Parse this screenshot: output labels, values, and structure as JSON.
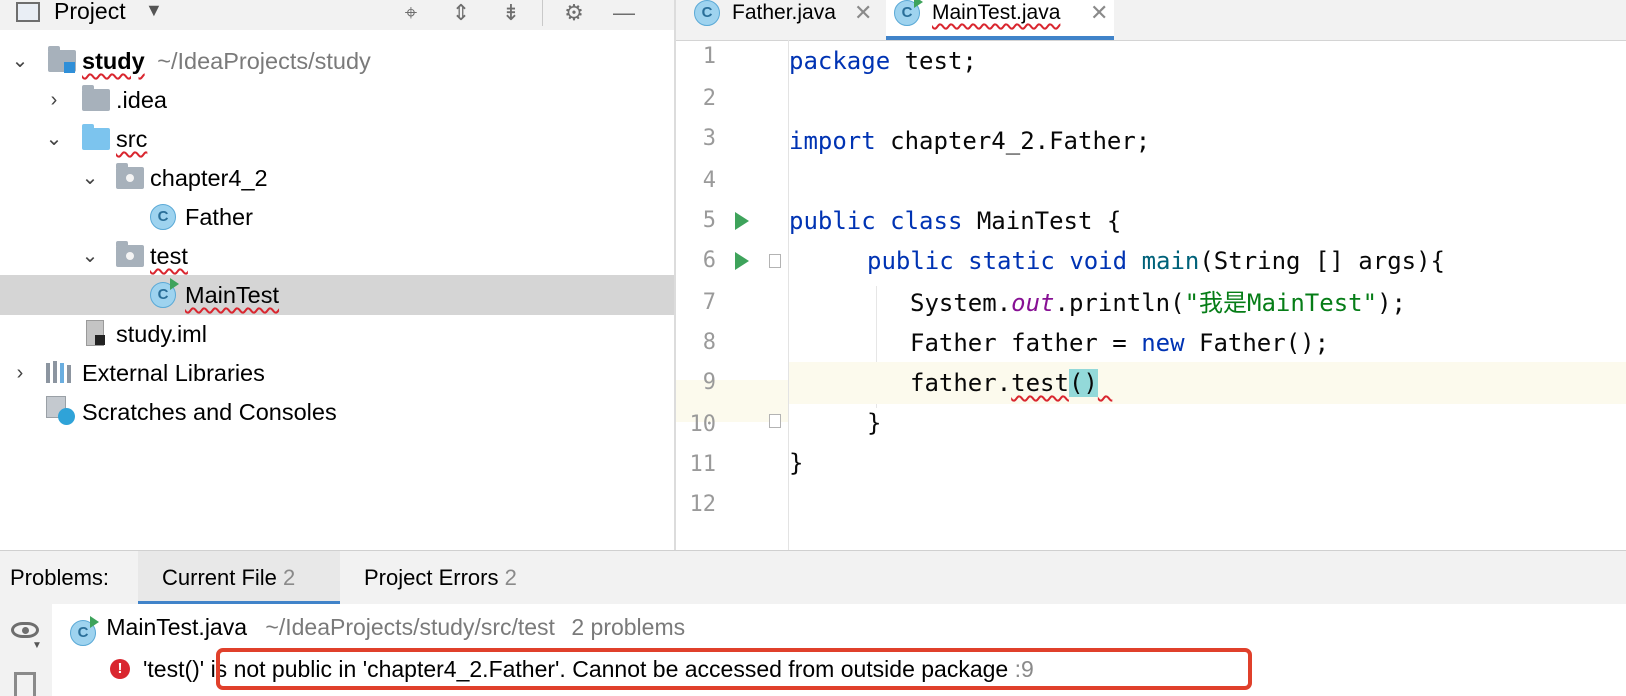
{
  "project_panel": {
    "title": "Project",
    "tree": [
      {
        "label": "study",
        "extra": "~/IdeaProjects/study"
      },
      {
        "label": ".idea"
      },
      {
        "label": "src"
      },
      {
        "label": "chapter4_2"
      },
      {
        "label": "Father"
      },
      {
        "label": "test"
      },
      {
        "label": "MainTest"
      },
      {
        "label": "study.iml"
      },
      {
        "label": "External Libraries"
      },
      {
        "label": "Scratches and Consoles"
      }
    ],
    "selected": "MainTest"
  },
  "editor": {
    "tabs": [
      {
        "label": "Father.java",
        "active": false
      },
      {
        "label": "MainTest.java",
        "active": true
      }
    ],
    "line_numbers": [
      "1",
      "2",
      "3",
      "4",
      "5",
      "6",
      "7",
      "8",
      "9",
      "10",
      "11",
      "12"
    ],
    "current_line": "9",
    "code": {
      "l1_kw": "package",
      "l1_rest": " test;",
      "l3_kw": "import",
      "l3_rest": " chapter4_2.Father;",
      "l5_kw1": "public",
      "l5_kw2": "class",
      "l5_rest": " MainTest {",
      "l6_kw1": "public",
      "l6_kw2": "static",
      "l6_kw3": "void",
      "l6_mth": "main",
      "l6_rest": "(String [] args){",
      "l7_a": "System.",
      "l7_fld": "out",
      "l7_b": ".println(",
      "l7_str": "\"我是MainTest\"",
      "l7_c": ");",
      "l8_a": "Father father = ",
      "l8_kw": "new",
      "l8_b": " Father();",
      "l9_a": "father.",
      "l9_err": "test",
      "l9_paren": "()",
      "l10": "}",
      "l11": "}"
    }
  },
  "problems": {
    "label": "Problems:",
    "tabs": [
      {
        "label": "Current File",
        "count": "2",
        "active": true
      },
      {
        "label": "Project Errors",
        "count": "2",
        "active": false
      }
    ],
    "file": {
      "name": "MainTest.java",
      "path": "~/IdeaProjects/study/src/test",
      "count": "2 problems"
    },
    "error": {
      "message": "'test()' is not public in 'chapter4_2.Father'. Cannot be accessed from outside package",
      "line": ":9"
    }
  },
  "colors": {
    "keyword": "#0033b3",
    "string": "#067d17",
    "error": "#d9262f",
    "accent": "#4083c9",
    "highlight_box": "#e0402b"
  }
}
